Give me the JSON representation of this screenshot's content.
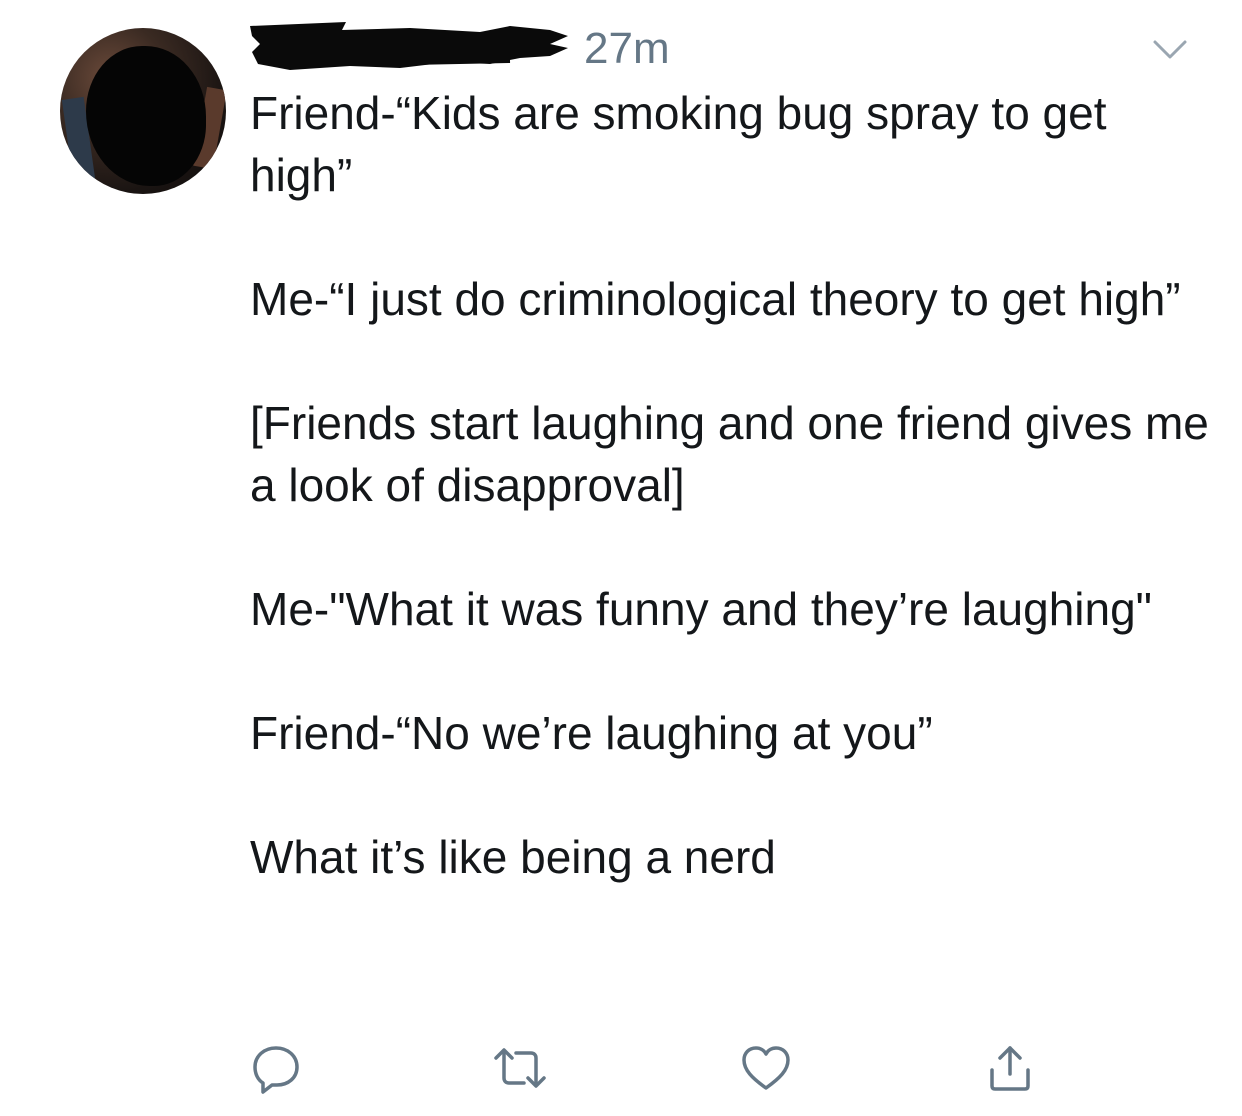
{
  "tweet": {
    "timestamp": "27m",
    "paragraphs": [
      "Friend-“Kids are smoking bug spray to get high”",
      "Me-“I just do criminological theory to get high”",
      "[Friends start laughing and one friend gives me a look of disapproval]",
      "Me-\"What it was funny and they’re laughing\"",
      "Friend-“No we’re laughing at you”",
      "What it’s like being a nerd"
    ]
  },
  "icons": {
    "menu": "chevron-down-icon",
    "reply": "reply-icon",
    "retweet": "retweet-icon",
    "like": "heart-icon",
    "share": "share-icon"
  },
  "colors": {
    "text": "#14171a",
    "muted": "#657786",
    "icon": "#657786",
    "background": "#ffffff"
  }
}
